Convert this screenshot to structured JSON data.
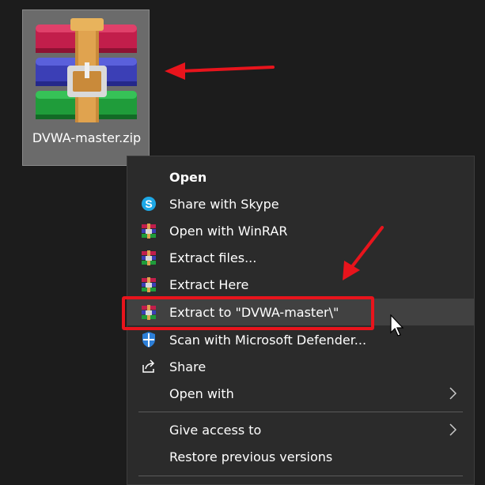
{
  "desktop": {
    "file": {
      "name": "DVWA-master.zip",
      "icon": "winrar-archive-icon"
    }
  },
  "context_menu": {
    "items": [
      {
        "label": "Open",
        "icon": "",
        "bold": true
      },
      {
        "label": "Share with Skype",
        "icon": "skype-icon"
      },
      {
        "label": "Open with WinRAR",
        "icon": "winrar-icon"
      },
      {
        "label": "Extract files...",
        "icon": "winrar-icon"
      },
      {
        "label": "Extract Here",
        "icon": "winrar-icon"
      },
      {
        "label": "Extract to \"DVWA-master\\\"",
        "icon": "winrar-icon",
        "highlighted": true
      },
      {
        "label": "Scan with Microsoft Defender...",
        "icon": "defender-shield-icon"
      },
      {
        "label": "Share",
        "icon": "share-icon"
      },
      {
        "label": "Open with",
        "icon": "",
        "submenu": true
      },
      {
        "label": "Give access to",
        "icon": "",
        "submenu": true
      },
      {
        "label": "Restore previous versions",
        "icon": ""
      }
    ]
  },
  "colors": {
    "background": "#1c1c1c",
    "menu_background": "#2b2b2b",
    "hover": "#414141",
    "annotation_red": "#e8141c",
    "file_selection": "#6b6b6b"
  }
}
